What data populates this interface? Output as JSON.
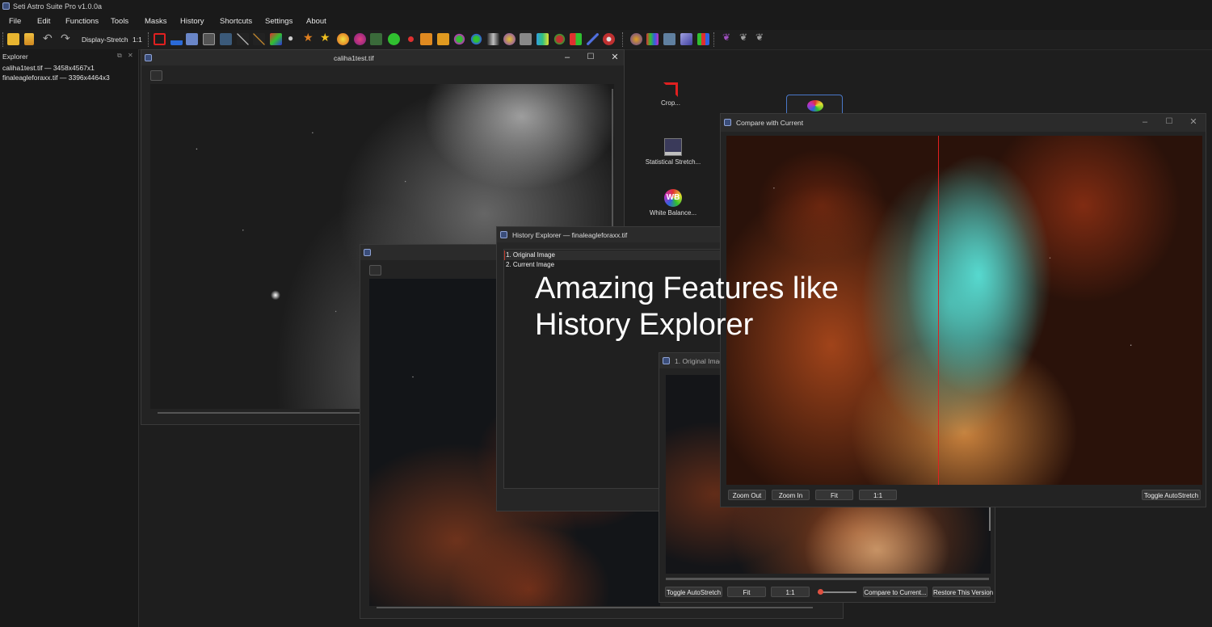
{
  "app": {
    "title": "Seti Astro Suite Pro v1.0.0a"
  },
  "menu": [
    "File",
    "Edit",
    "Functions",
    "Tools",
    "Masks",
    "History",
    "Shortcuts",
    "Settings",
    "About"
  ],
  "toolbar": {
    "display_stretch": "Display-Stretch",
    "ratio": "1:1"
  },
  "explorer": {
    "title": "Explorer",
    "items": [
      "caliha1test.tif  —  3458x4567x1",
      "finaleagleforaxx.tif  —  3396x4464x3"
    ]
  },
  "windows": {
    "caliha": {
      "title": "caliha1test.tif"
    },
    "history": {
      "title": "History Explorer — finaleagleforaxx.tif",
      "items": [
        "1. Original Image",
        "2. Current Image"
      ]
    },
    "original": {
      "title": "1. Original Image",
      "buttons": [
        "Toggle AutoStretch",
        "Fit",
        "1:1",
        "Compare to Current...",
        "Restore This Version"
      ]
    },
    "compare": {
      "title": "Compare with Current",
      "buttons": [
        "Zoom Out",
        "Zoom In",
        "Fit",
        "1:1"
      ],
      "toggle": "Toggle AutoStretch"
    }
  },
  "desktop": {
    "crop": "Crop...",
    "stat": "Statistical Stretch...",
    "wb": "White Balance..."
  },
  "overlay": {
    "line1": "Amazing Features like",
    "line2": "History Explorer"
  },
  "colors": {
    "accent": "#c0392b",
    "background": "#1e1e1e",
    "selection_border": "#4a78c8"
  }
}
